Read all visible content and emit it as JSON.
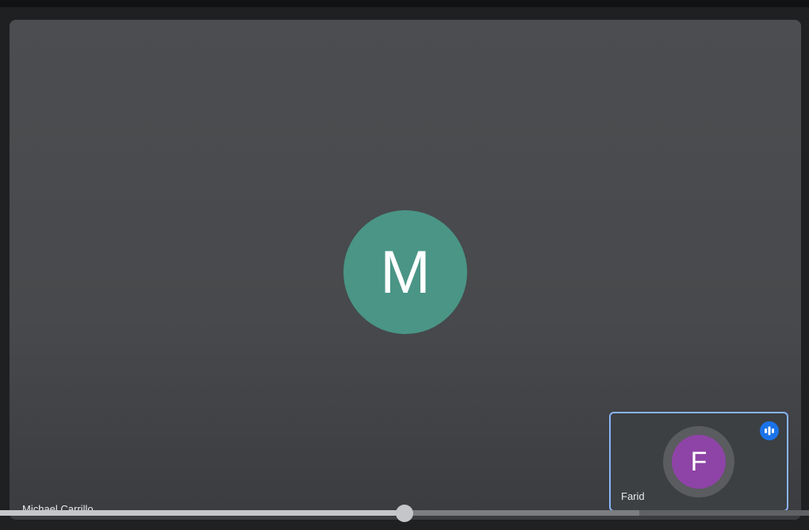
{
  "main_participant": {
    "initial": "M",
    "name": "Michael Carrillo",
    "avatar_color": "#4a9586"
  },
  "self_tile": {
    "initial": "F",
    "name": "Farid",
    "avatar_color": "#8e44a6",
    "highlight_color": "#8ab4f8",
    "speaking_icon": "audio-level-icon"
  },
  "playback": {
    "progress": 0.5,
    "buffered": 0.79
  }
}
